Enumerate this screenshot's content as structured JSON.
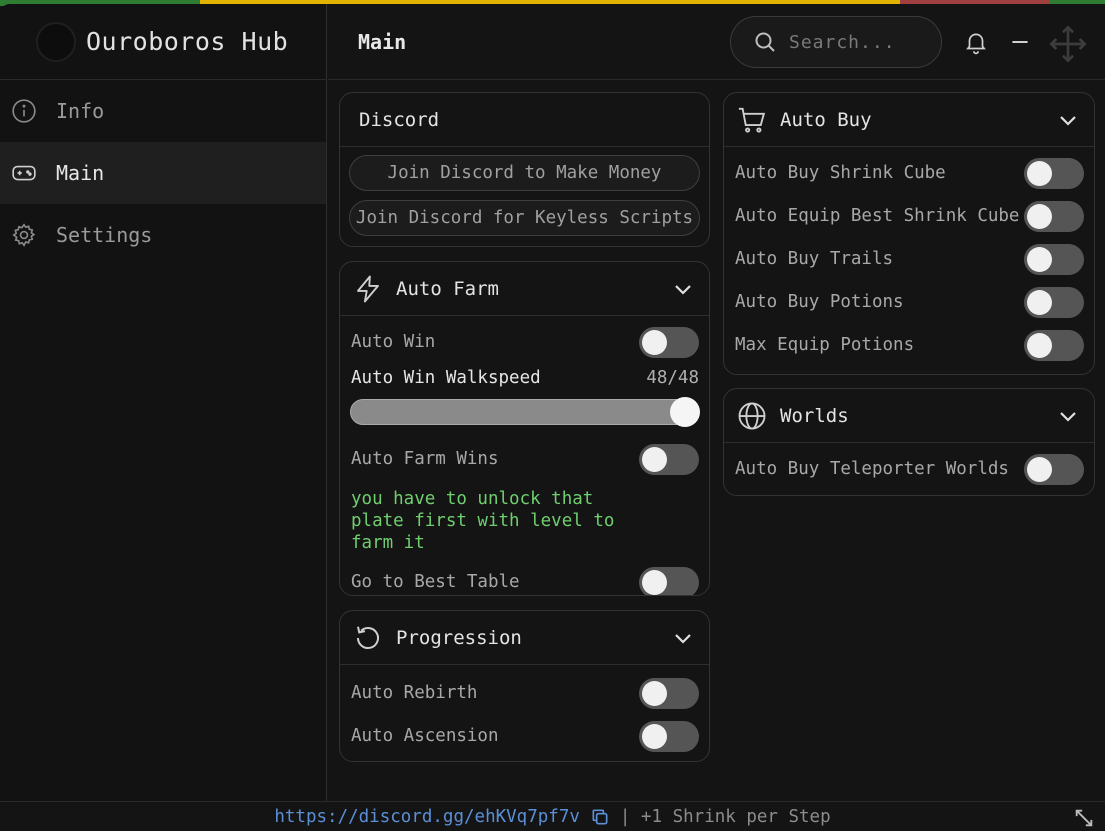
{
  "app": {
    "title": "Ouroboros Hub"
  },
  "sidebar": {
    "items": [
      {
        "label": "Info",
        "icon": "info-icon",
        "active": false
      },
      {
        "label": "Main",
        "icon": "gamepad-icon",
        "active": true
      },
      {
        "label": "Settings",
        "icon": "gear-icon",
        "active": false
      }
    ]
  },
  "header": {
    "title": "Main",
    "search_placeholder": "Search..."
  },
  "discord": {
    "title": "Discord",
    "buttons": [
      "Join Discord to Make Money",
      "Join Discord for Keyless Scripts"
    ]
  },
  "auto_farm": {
    "title": "Auto Farm",
    "auto_win": "Auto Win",
    "slider_label": "Auto Win Walkspeed",
    "slider_value": "48/48",
    "slider_fraction": 1.0,
    "auto_farm_wins": "Auto Farm Wins",
    "note": "you have to unlock that plate first with level to farm it",
    "best_table": "Go to Best Table"
  },
  "progression": {
    "title": "Progression",
    "rows": [
      "Auto Rebirth",
      "Auto Ascension"
    ]
  },
  "auto_buy": {
    "title": "Auto Buy",
    "rows": [
      "Auto Buy Shrink Cube",
      "Auto Equip Best Shrink Cube",
      "Auto Buy Trails",
      "Auto Buy Potions",
      "Max Equip Potions"
    ]
  },
  "worlds": {
    "title": "Worlds",
    "rows": [
      "Auto Buy Teleporter Worlds"
    ]
  },
  "footer": {
    "link": "https://discord.gg/ehKVq7pf7v",
    "text": "| +1 Shrink per Step"
  },
  "colors": {
    "background": "#141414",
    "note_green": "#6fcf6f",
    "link_blue": "#5b8fd6",
    "toggle_off": "#555555"
  }
}
